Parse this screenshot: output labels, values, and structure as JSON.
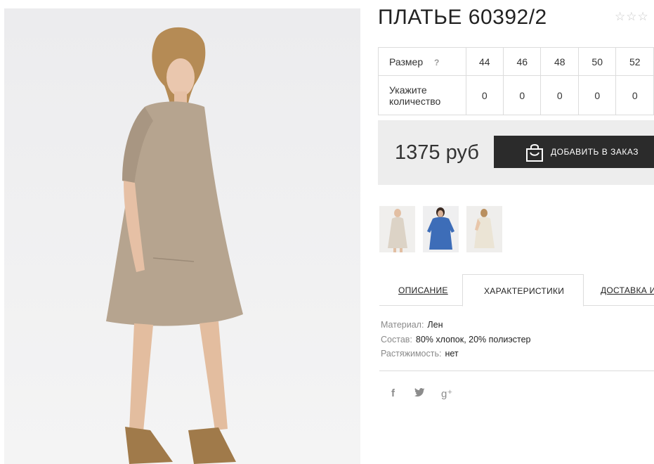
{
  "product": {
    "title": "ПЛАТЬЕ 60392/2",
    "rating_stars": "☆☆☆"
  },
  "size_table": {
    "size_label": "Размер",
    "help_mark": "?",
    "sizes": [
      "44",
      "46",
      "48",
      "50",
      "52"
    ],
    "qty_label": "Укажите количество",
    "quantities": [
      "0",
      "0",
      "0",
      "0",
      "0"
    ]
  },
  "purchase": {
    "price": "1375 руб",
    "add_button": "ДОБАВИТЬ В ЗАКАЗ"
  },
  "tabs": [
    {
      "label": "ОПИСАНИЕ"
    },
    {
      "label": "ХАРАКТЕРИСТИКИ"
    },
    {
      "label": "ДОСТАВКА И"
    }
  ],
  "specs": [
    {
      "key": "Материал:",
      "value": "Лен"
    },
    {
      "key": "Состав:",
      "value": "80% хлопок, 20% полиэстер"
    },
    {
      "key": "Растяжимость:",
      "value": "нет"
    }
  ],
  "social": {
    "facebook": "f",
    "twitter": "🐦",
    "gplus": "g⁺"
  },
  "colors": {
    "button_bg": "#2b2b2b",
    "price_bg": "#ededed",
    "border": "#dcdcdc"
  },
  "icons": [
    "bag-icon",
    "star-icon",
    "facebook-icon",
    "twitter-icon",
    "google-plus-icon"
  ]
}
